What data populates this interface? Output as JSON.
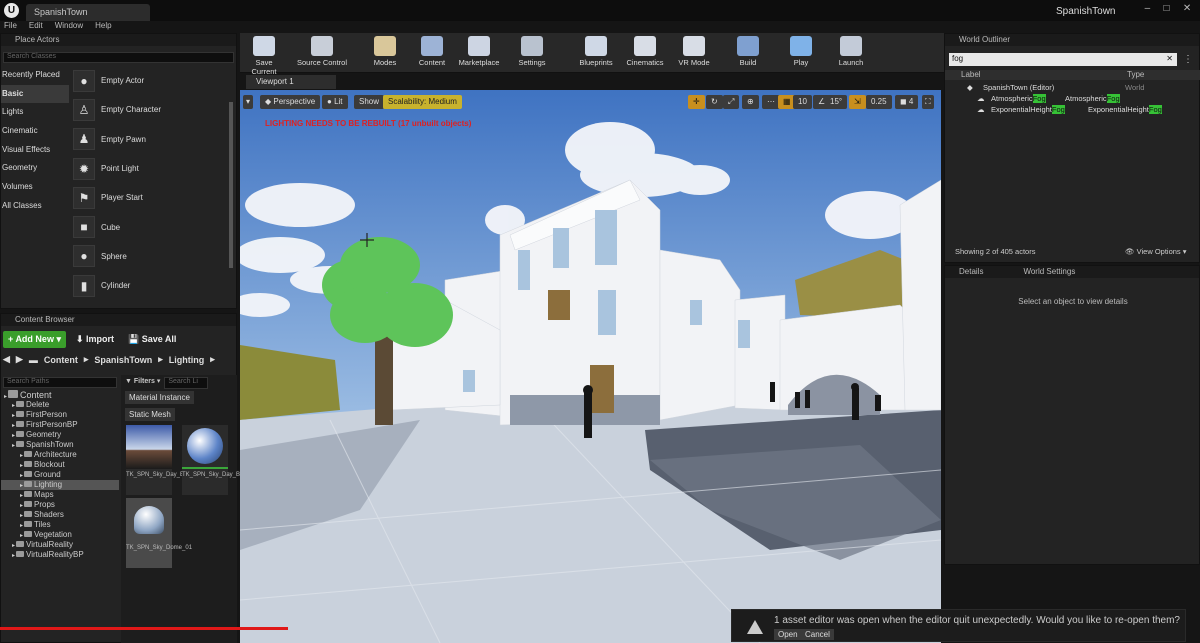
{
  "window": {
    "tab_title": "SpanishTown",
    "project_name": "SpanishTown",
    "logo": "U"
  },
  "menu": [
    "File",
    "Edit",
    "Window",
    "Help"
  ],
  "place_actors": {
    "title": "Place Actors",
    "search_placeholder": "Search Classes",
    "categories": [
      "Recently Placed",
      "Basic",
      "Lights",
      "Cinematic",
      "Visual Effects",
      "Geometry",
      "Volumes",
      "All Classes"
    ],
    "selected_category": "Basic",
    "items": [
      {
        "label": "Empty Actor",
        "icon": "sphere-icon"
      },
      {
        "label": "Empty Character",
        "icon": "figure-icon"
      },
      {
        "label": "Empty Pawn",
        "icon": "pawn-icon"
      },
      {
        "label": "Point Light",
        "icon": "bulb-icon"
      },
      {
        "label": "Player Start",
        "icon": "flag-icon"
      },
      {
        "label": "Cube",
        "icon": "cube-icon"
      },
      {
        "label": "Sphere",
        "icon": "sphere-icon"
      },
      {
        "label": "Cylinder",
        "icon": "cylinder-icon"
      }
    ]
  },
  "content_browser": {
    "title": "Content Browser",
    "add_new": "Add New",
    "import": "Import",
    "save_all": "Save All",
    "path": [
      "Content",
      "SpanishTown",
      "Lighting"
    ],
    "search_paths_placeholder": "Search Paths",
    "filters": "Filters",
    "search_assets_placeholder": "Search Li",
    "filter_chips": [
      "Material Instance",
      "Static Mesh"
    ],
    "tree": [
      {
        "label": "Content",
        "depth": 0
      },
      {
        "label": "Delete",
        "depth": 1
      },
      {
        "label": "FirstPerson",
        "depth": 1
      },
      {
        "label": "FirstPersonBP",
        "depth": 1
      },
      {
        "label": "Geometry",
        "depth": 1
      },
      {
        "label": "SpanishTown",
        "depth": 1
      },
      {
        "label": "Architecture",
        "depth": 2
      },
      {
        "label": "Blockout",
        "depth": 2
      },
      {
        "label": "Ground",
        "depth": 2
      },
      {
        "label": "Lighting",
        "depth": 2
      },
      {
        "label": "Maps",
        "depth": 2
      },
      {
        "label": "Props",
        "depth": 2
      },
      {
        "label": "Shaders",
        "depth": 2
      },
      {
        "label": "Tiles",
        "depth": 2
      },
      {
        "label": "Vegetation",
        "depth": 2
      },
      {
        "label": "VirtualReality",
        "depth": 1
      },
      {
        "label": "VirtualRealityBP",
        "depth": 1
      }
    ],
    "selected_tree_item": "Lighting",
    "assets": [
      {
        "label": "TK_SPN_Sky_Day_Bright_01"
      },
      {
        "label": "TK_SPN_Sky_Day_Bright_01_Inst"
      },
      {
        "label": "TK_SPN_Sky_Dome_01"
      }
    ]
  },
  "toolbar": [
    {
      "label": "Save Current",
      "icon": "save-icon"
    },
    {
      "label": "Source Control",
      "icon": "source-control-icon"
    },
    {
      "label": "Modes",
      "icon": "modes-icon"
    },
    {
      "label": "Content",
      "icon": "content-icon"
    },
    {
      "label": "Marketplace",
      "icon": "marketplace-icon"
    },
    {
      "label": "Settings",
      "icon": "settings-icon"
    },
    {
      "label": "Blueprints",
      "icon": "blueprints-icon"
    },
    {
      "label": "Cinematics",
      "icon": "cinematics-icon"
    },
    {
      "label": "VR Mode",
      "icon": "vr-icon"
    },
    {
      "label": "Build",
      "icon": "build-icon"
    },
    {
      "label": "Play",
      "icon": "play-icon"
    },
    {
      "label": "Launch",
      "icon": "launch-icon"
    }
  ],
  "viewport": {
    "tab": "Viewport 1",
    "perspective": "Perspective",
    "lit": "Lit",
    "show": "Show",
    "scalability": "Scalability: Medium",
    "lighting_warning": "LIGHTING NEEDS TO BE REBUILT (17 unbuilt objects)",
    "grid_snap": "10",
    "rotation_snap": "15°",
    "scale_snap": "0.25",
    "camera_speed": "4"
  },
  "world_outliner": {
    "title": "World Outliner",
    "search_value": "fog",
    "columns": [
      "Label",
      "Type"
    ],
    "rows": [
      {
        "label": "SpanishTown (Editor)",
        "type": "World"
      },
      {
        "label_prefix": "Atmospheric",
        "label_match": "Fog",
        "type_prefix": "Atmospheric",
        "type_match": "Fog"
      },
      {
        "label_prefix": "ExponentialHeight",
        "label_match": "Fog",
        "type_prefix": "ExponentialHeight",
        "type_match": "Fog"
      }
    ],
    "footer": "Showing 2 of 405 actors",
    "view_options": "View Options"
  },
  "details": {
    "tab": "Details",
    "world_settings_tab": "World Settings",
    "empty_text": "Select an object to view details"
  },
  "notification": {
    "text": "1 asset editor was open when the editor quit unexpectedly. Would you like to re-open them?",
    "open": "Open",
    "cancel": "Cancel"
  },
  "video_progress": 0.24
}
